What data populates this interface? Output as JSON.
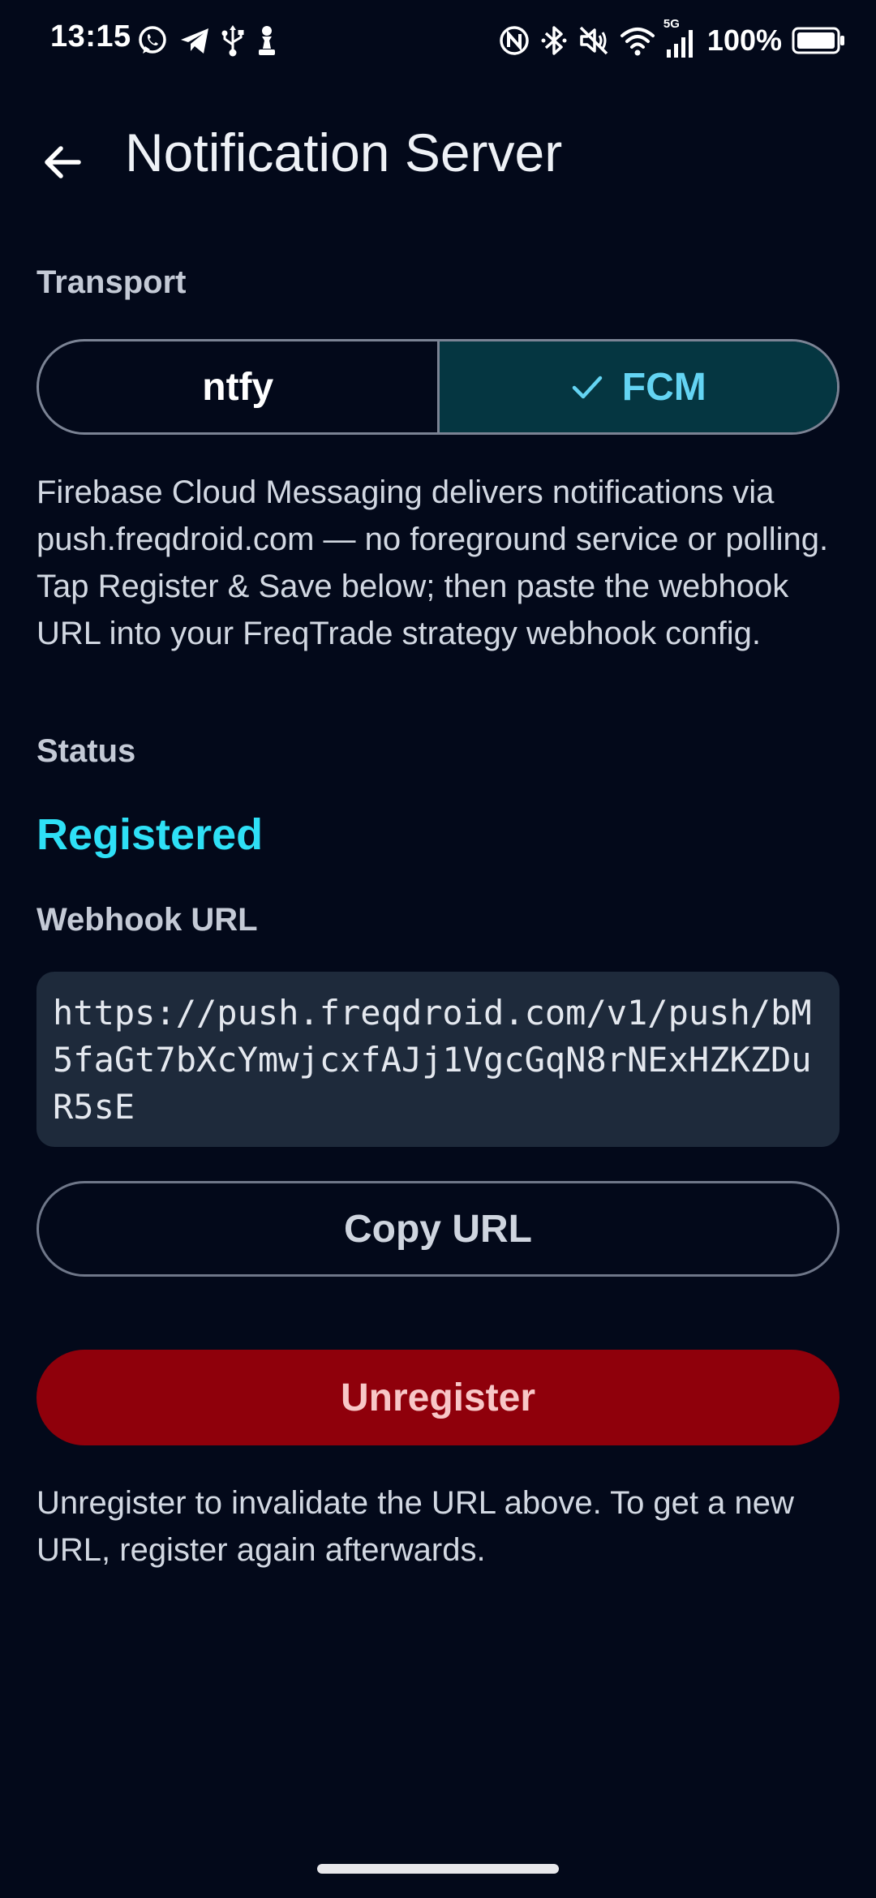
{
  "status_bar": {
    "time": "13:15",
    "network_label": "5G",
    "battery": "100%",
    "left_icons": [
      "whatsapp-icon",
      "telegram-icon",
      "usb-icon",
      "chess-pawn-icon"
    ],
    "right_icons": [
      "nfc-icon",
      "bluetooth-icon",
      "mute-icon",
      "wifi-icon",
      "signal-icon",
      "battery-icon"
    ]
  },
  "app_bar": {
    "title": "Notification Server",
    "back_icon": "arrow-left-icon"
  },
  "transport": {
    "label": "Transport",
    "options": [
      {
        "label": "ntfy",
        "selected": false
      },
      {
        "label": "FCM",
        "selected": true
      }
    ],
    "check_icon": "check-icon"
  },
  "description": "Firebase Cloud Messaging delivers notifications via push.freqdroid.com — no foreground service or polling. Tap Register & Save below; then paste the webhook URL into your FreqTrade strategy webhook config.",
  "status": {
    "label": "Status",
    "value": "Registered"
  },
  "webhook": {
    "label": "Webhook URL",
    "url": "https://push.freqdroid.com/v1/push/bM5faGt7bXcYmwjcxfAJj1VgcGqN8rNExHZKZDuR5sE"
  },
  "actions": {
    "copy_label": "Copy URL",
    "unregister_label": "Unregister"
  },
  "footnote": "Unregister to invalidate the URL above. To get a new URL, register again afterwards.",
  "colors": {
    "background": "#03091a",
    "accent": "#2ee0f6",
    "selected_segment": "#053641",
    "danger": "#8f000b"
  }
}
